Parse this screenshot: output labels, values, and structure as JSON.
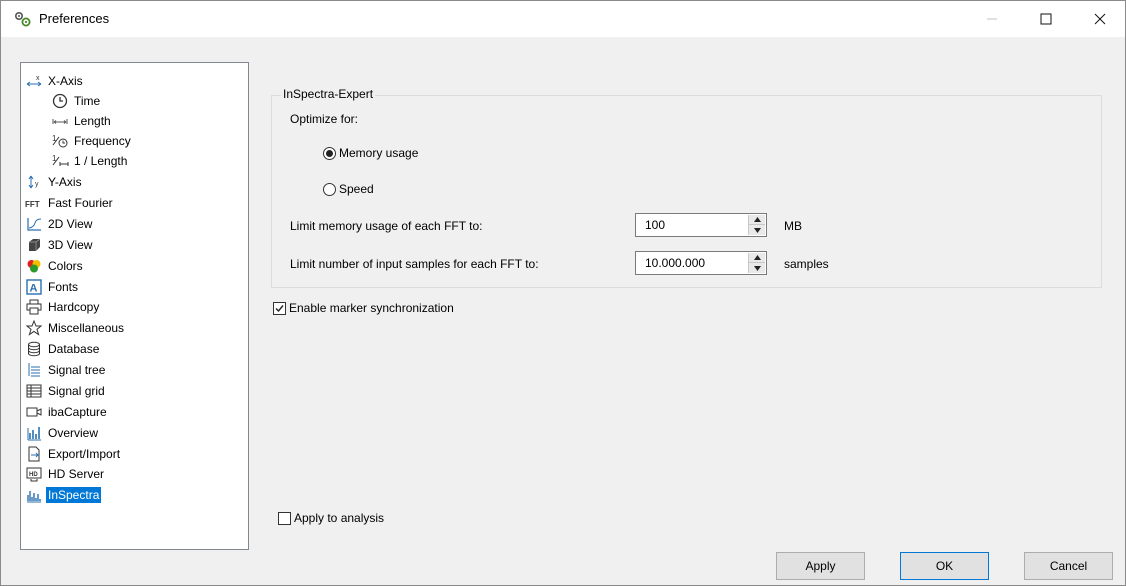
{
  "window": {
    "title": "Preferences"
  },
  "tree": {
    "items": [
      {
        "label": "X-Axis",
        "icon": "x-axis-icon"
      },
      {
        "label": "Time",
        "icon": "clock-icon"
      },
      {
        "label": "Length",
        "icon": "length-icon"
      },
      {
        "label": "Frequency",
        "icon": "frequency-icon"
      },
      {
        "label": "1 / Length",
        "icon": "inverse-length-icon"
      },
      {
        "label": "Y-Axis",
        "icon": "y-axis-icon"
      },
      {
        "label": "Fast Fourier",
        "icon": "fft-icon"
      },
      {
        "label": "2D View",
        "icon": "2d-view-icon"
      },
      {
        "label": "3D View",
        "icon": "3d-view-icon"
      },
      {
        "label": "Colors",
        "icon": "colors-icon"
      },
      {
        "label": "Fonts",
        "icon": "fonts-icon"
      },
      {
        "label": "Hardcopy",
        "icon": "printer-icon"
      },
      {
        "label": "Miscellaneous",
        "icon": "star-icon"
      },
      {
        "label": "Database",
        "icon": "database-icon"
      },
      {
        "label": "Signal tree",
        "icon": "signal-tree-icon"
      },
      {
        "label": "Signal grid",
        "icon": "signal-grid-icon"
      },
      {
        "label": "ibaCapture",
        "icon": "camera-icon"
      },
      {
        "label": "Overview",
        "icon": "overview-icon"
      },
      {
        "label": "Export/Import",
        "icon": "export-import-icon"
      },
      {
        "label": "HD Server",
        "icon": "hd-server-icon"
      },
      {
        "label": "InSpectra",
        "icon": "inspectra-icon",
        "selected": true
      }
    ]
  },
  "panel": {
    "group_title": "InSpectra-Expert",
    "optimize_label": "Optimize for:",
    "radio_memory": "Memory usage",
    "radio_speed": "Speed",
    "selected_option": "Memory usage",
    "limit_memory_label": "Limit memory usage of each FFT to:",
    "limit_memory_value": "100",
    "limit_memory_unit": "MB",
    "limit_samples_label": "Limit number of input samples for each FFT to:",
    "limit_samples_value": "10.000.000",
    "limit_samples_unit": "samples",
    "enable_marker_sync_label": "Enable marker synchronization",
    "enable_marker_sync_checked": true,
    "apply_to_analysis_label": "Apply to analysis",
    "apply_to_analysis_checked": false
  },
  "buttons": {
    "apply": "Apply",
    "ok": "OK",
    "cancel": "Cancel"
  },
  "colors": {
    "selection": "#0078d7",
    "dialog_bg": "#f0f0f0"
  }
}
